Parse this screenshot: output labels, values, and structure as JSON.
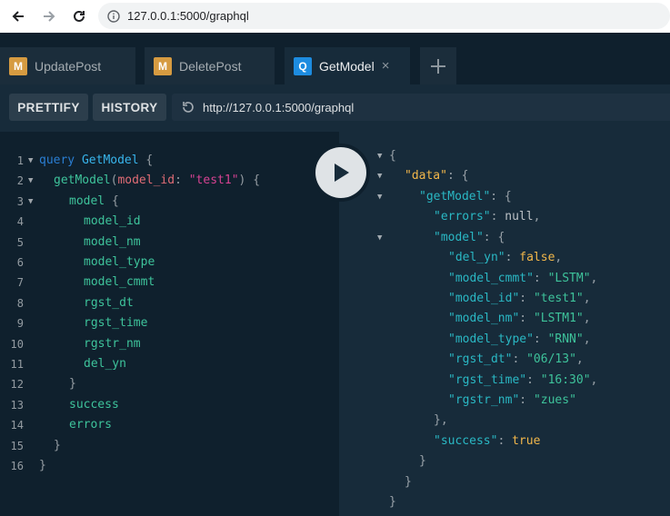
{
  "browser": {
    "url": "127.0.0.1:5000/graphql"
  },
  "tabs": [
    {
      "badge": "M",
      "label": "UpdatePost"
    },
    {
      "badge": "M",
      "label": "DeletePost"
    },
    {
      "badge": "Q",
      "label": "GetModel",
      "close": "×"
    },
    {
      "label": "+"
    }
  ],
  "toolbar": {
    "prettify": "PRETTIFY",
    "history": "HISTORY",
    "endpoint": "http://127.0.0.1:5000/graphql"
  },
  "editor": {
    "line_numbers": [
      "1",
      "2",
      "3",
      "4",
      "5",
      "6",
      "7",
      "8",
      "9",
      "10",
      "11",
      "12",
      "13",
      "14",
      "15",
      "16"
    ],
    "lines": {
      "l1_kw": "query",
      "l1_name": "GetModel",
      "l1_brace": "{",
      "l2_fn": "getModel",
      "l2_open": "(",
      "l2_arg": "model_id",
      "l2_colon": ":",
      "l2_val": "\"test1\"",
      "l2_close": ")",
      "l2_brace": "{",
      "l3_field": "model",
      "l3_brace": "{",
      "l4": "model_id",
      "l5": "model_nm",
      "l6": "model_type",
      "l7": "model_cmmt",
      "l8": "rgst_dt",
      "l9": "rgst_time",
      "l10": "rgstr_nm",
      "l11": "del_yn",
      "l12": "}",
      "l13": "success",
      "l14": "errors",
      "l15": "}",
      "l16": "}"
    }
  },
  "result": {
    "r1": "{",
    "r2_key": "\"data\"",
    "r2_rest": ": {",
    "r3_key": "\"getModel\"",
    "r3_rest": ": {",
    "r4_key": "\"errors\"",
    "r4_colon": ": ",
    "r4_val": "null",
    "r4_comma": ",",
    "r5_key": "\"model\"",
    "r5_rest": ": {",
    "r6_key": "\"del_yn\"",
    "r6_colon": ": ",
    "r6_val": "false",
    "r6_comma": ",",
    "r7_key": "\"model_cmmt\"",
    "r7_colon": ": ",
    "r7_val": "\"LSTM\"",
    "r7_comma": ",",
    "r8_key": "\"model_id\"",
    "r8_colon": ": ",
    "r8_val": "\"test1\"",
    "r8_comma": ",",
    "r9_key": "\"model_nm\"",
    "r9_colon": ": ",
    "r9_val": "\"LSTM1\"",
    "r9_comma": ",",
    "r10_key": "\"model_type\"",
    "r10_colon": ": ",
    "r10_val": "\"RNN\"",
    "r10_comma": ",",
    "r11_key": "\"rgst_dt\"",
    "r11_colon": ": ",
    "r11_val": "\"06/13\"",
    "r11_comma": ",",
    "r12_key": "\"rgst_time\"",
    "r12_colon": ": ",
    "r12_val": "\"16:30\"",
    "r12_comma": ",",
    "r13_key": "\"rgstr_nm\"",
    "r13_colon": ": ",
    "r13_val": "\"zues\"",
    "r14": "},",
    "r15_key": "\"success\"",
    "r15_colon": ": ",
    "r15_val": "true",
    "r16": "}",
    "r17": "}",
    "r18": "}"
  },
  "colors": {
    "background": "#172b3a",
    "editor_bg": "#0f202d",
    "mutation_badge": "#d69b41",
    "query_badge": "#1d8ce0"
  },
  "icons": [
    "back-arrow-icon",
    "forward-arrow-icon",
    "reload-icon",
    "info-icon",
    "close-icon",
    "plus-icon",
    "endpoint-reload-icon",
    "play-icon",
    "fold-arrow-icon"
  ]
}
